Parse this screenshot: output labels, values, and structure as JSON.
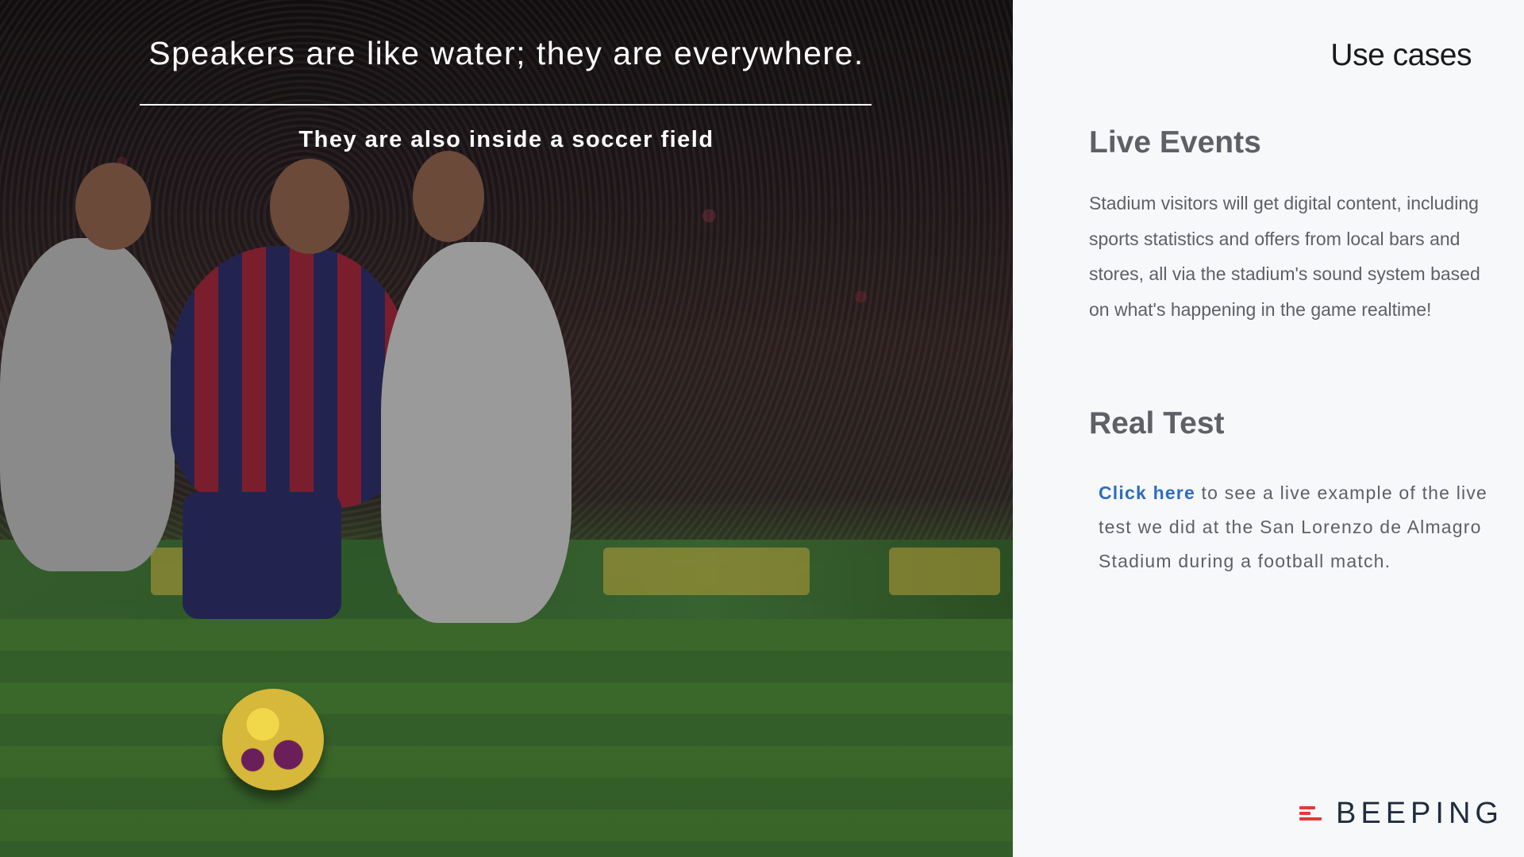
{
  "hero": {
    "title": "Speakers are like water; they are everywhere.",
    "subtitle": "They are also inside a soccer field"
  },
  "panel": {
    "heading": "Use cases",
    "sections": [
      {
        "title": "Live Events",
        "body": "Stadium visitors will get digital content, including sports statistics and offers from local bars and stores, all via the stadium's sound system based on what's happening in the game realtime!"
      },
      {
        "title": "Real Test",
        "link_label": "Click here",
        "body": " to see a live example of the live test we did at the San Lorenzo de Almagro Stadium during a football match."
      }
    ]
  },
  "logo": {
    "text": "BEEPING",
    "accent_color": "#e13a3a",
    "text_color": "#1f2d3d"
  },
  "colors": {
    "link": "#2e6cc0",
    "section_text": "#5f5f66",
    "panel_background": "#f7f8fa"
  }
}
